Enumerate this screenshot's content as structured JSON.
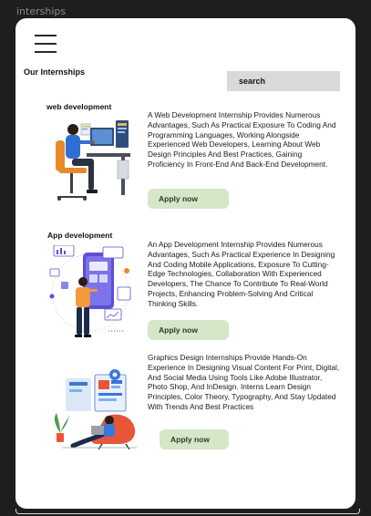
{
  "frame": {
    "label": "interships"
  },
  "page": {
    "heading": "Our Internships",
    "search": {
      "value": "search"
    }
  },
  "internships": [
    {
      "title": "web development",
      "description": "A Web Development Internship Provides Numerous Advantages, Such As Practical Exposure To Coding And Programming Languages, Working Alongside Experienced Web Developers, Learning About Web Design Principles And Best Practices, Gaining Proficiency In Front-End And Back-End Development.",
      "button": "Apply now"
    },
    {
      "title": "App development",
      "description": "An App Development Internship Provides Numerous Advantages, Such As Practical Experience In Designing And Coding Mobile Applications, Exposure To Cutting-Edge Technologies, Collaboration With Experienced Developers, The Chance To Contribute To Real-World Projects, Enhancing Problem-Solving And Critical Thinking Skills.",
      "button": "Apply now"
    },
    {
      "title": "",
      "description": "Graphics Design Internships Provide Hands-On Experience In Designing Visual Content For Print, Digital, And Social Media Using Tools Like Adobe Illustrator, Photo Shop, And InDesign. Interns Learn Design Principles, Color Theory, Typography, And Stay Updated With Trends And Best Practices",
      "button": "Apply now"
    }
  ],
  "colors": {
    "background": "#1e1e1e",
    "card": "#ffffff",
    "button": "#d6e6c9",
    "search": "#d9d9d9"
  }
}
